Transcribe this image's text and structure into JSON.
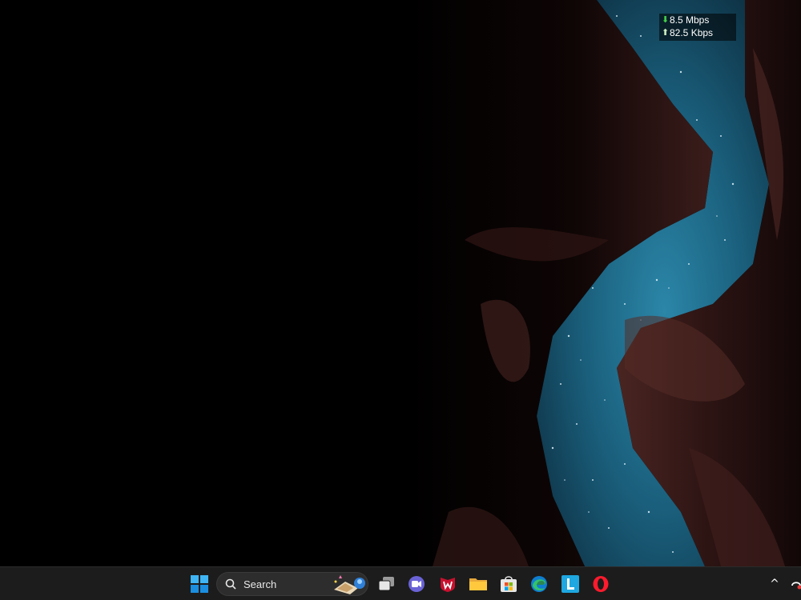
{
  "network_widget": {
    "download_arrow": "⬇",
    "download_speed": "8.5 Mbps",
    "upload_arrow": "⬆",
    "upload_speed": "82.5 Kbps"
  },
  "taskbar": {
    "search": {
      "label": "Search"
    },
    "pinned_apps": [
      {
        "name": "start-icon"
      },
      {
        "name": "task-view-icon"
      },
      {
        "name": "meet-icon"
      },
      {
        "name": "mcafee-icon"
      },
      {
        "name": "file-explorer-icon"
      },
      {
        "name": "microsoft-store-icon"
      },
      {
        "name": "edge-icon"
      },
      {
        "name": "l-app-icon"
      },
      {
        "name": "opera-icon"
      }
    ],
    "tray": {
      "chevron": "^",
      "icons": [
        "partial-tray-icon"
      ]
    }
  },
  "colors": {
    "taskbar_bg": "#1c1c1c",
    "sky": "#1f6e8c",
    "rock": "#3a1c1a",
    "download_arrow": "#44d04a"
  }
}
